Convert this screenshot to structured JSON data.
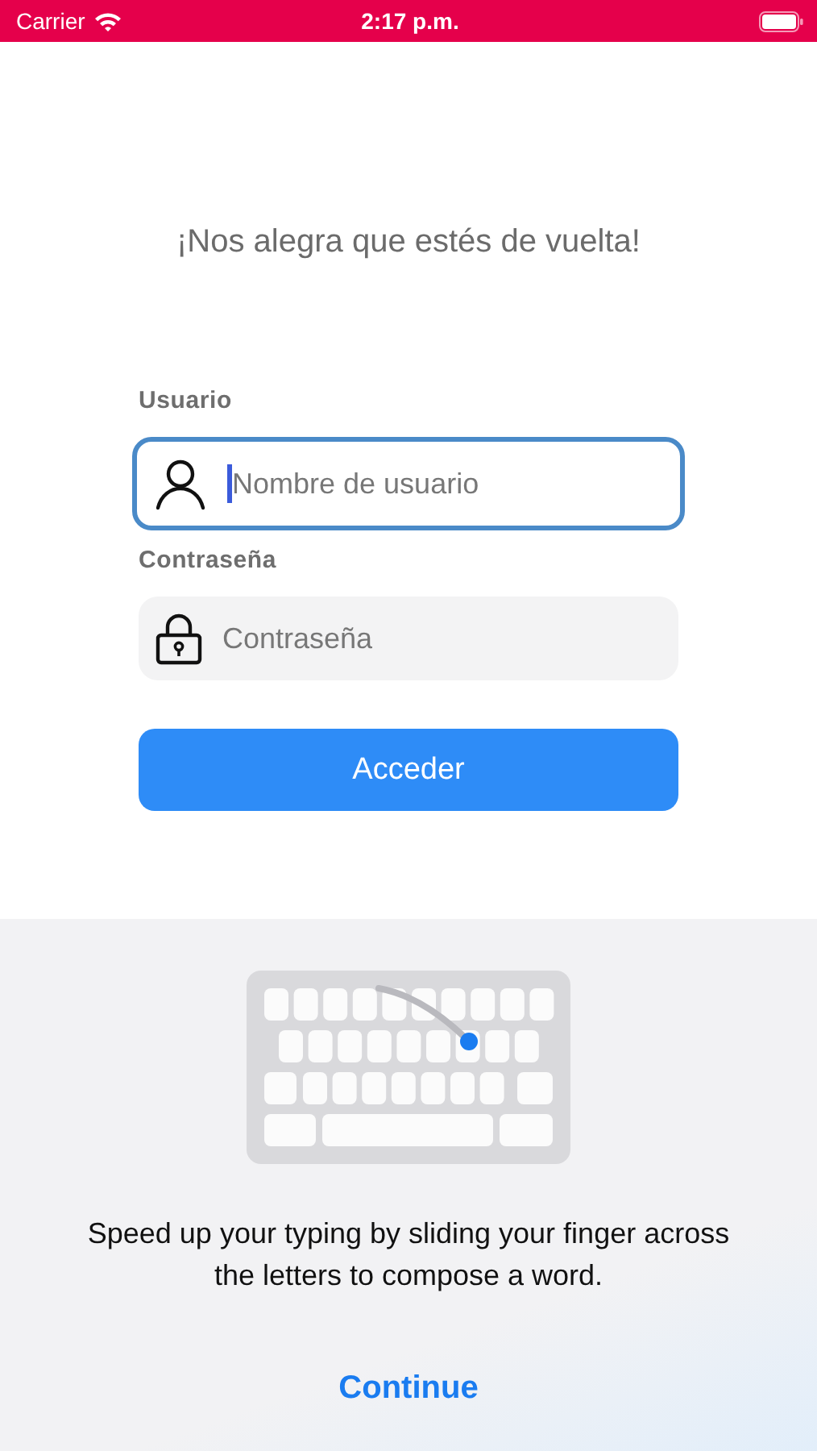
{
  "status_bar": {
    "carrier": "Carrier",
    "time": "2:17 p.m."
  },
  "login": {
    "heading": "¡Nos alegra que estés de vuelta!",
    "fields": [
      {
        "label": "Usuario",
        "placeholder": "Nombre de usuario",
        "kind": "user",
        "focused": true
      },
      {
        "label": "Contraseña",
        "placeholder": "Contraseña",
        "kind": "password",
        "focused": false
      }
    ],
    "button": "Acceder"
  },
  "keyboard_tip": {
    "message": "Speed up your typing by sliding your finger across the letters to compose a word.",
    "action": "Continue"
  }
}
